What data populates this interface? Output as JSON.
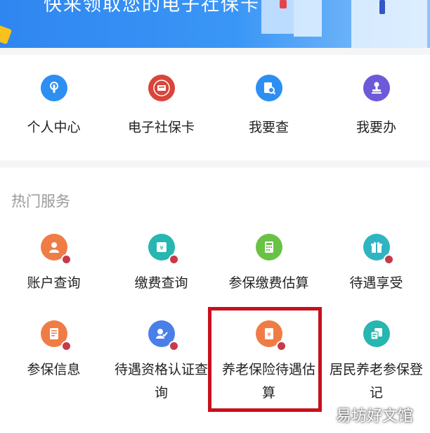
{
  "banner": {
    "text": "快来领取您的电子社保卡"
  },
  "quick_actions": [
    {
      "label": "个人中心",
      "icon": "touch-icon",
      "color": "#2e8ff2"
    },
    {
      "label": "电子社保卡",
      "icon": "social-card-icon",
      "color": "#d9453b"
    },
    {
      "label": "我要查",
      "icon": "document-search-icon",
      "color": "#2e8ff2"
    },
    {
      "label": "我要办",
      "icon": "stamp-icon",
      "color": "#6d5ad8"
    }
  ],
  "hot_services": {
    "title": "热门服务",
    "items": [
      {
        "label": "账户查询",
        "icon": "account-user-icon",
        "color": "#f07c45"
      },
      {
        "label": "缴费查询",
        "icon": "payment-icon",
        "color": "#27b6b0"
      },
      {
        "label": "参保缴费估算",
        "icon": "calculator-icon",
        "color": "#69c244"
      },
      {
        "label": "待遇享受",
        "icon": "gift-icon",
        "color": "#2fb4c2"
      },
      {
        "label": "参保信息",
        "icon": "info-doc-icon",
        "color": "#f07c45"
      },
      {
        "label": "待遇资格认证查询",
        "icon": "certification-icon",
        "color": "#4a7fe8"
      },
      {
        "label": "养老保险待遇估算",
        "icon": "pension-estimate-icon",
        "color": "#f07c45"
      },
      {
        "label": "居民养老参保登记",
        "icon": "resident-register-icon",
        "color": "#27b6b0"
      }
    ]
  },
  "watermark": "易坊好文馆"
}
